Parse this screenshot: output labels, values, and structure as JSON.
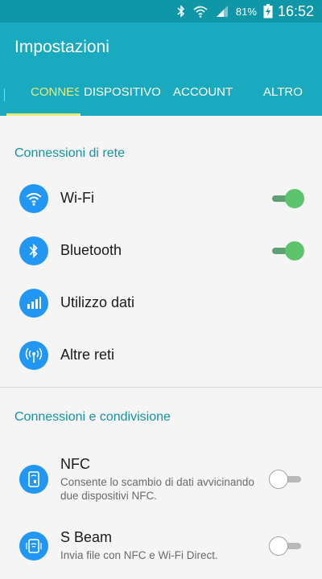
{
  "status_bar": {
    "battery": "81%",
    "time": "16:52"
  },
  "app_bar": {
    "title": "Impostazioni"
  },
  "tabs": [
    {
      "label": "CONNESSIONI"
    },
    {
      "label": "DISPOSITIVO"
    },
    {
      "label": "ACCOUNT"
    },
    {
      "label": "ALTRO"
    }
  ],
  "section1": {
    "header": "Connessioni di rete",
    "items": [
      {
        "label": "Wi-Fi",
        "toggle": true,
        "toggle_on": true
      },
      {
        "label": "Bluetooth",
        "toggle": true,
        "toggle_on": true
      },
      {
        "label": "Utilizzo dati"
      },
      {
        "label": "Altre reti"
      }
    ]
  },
  "section2": {
    "header": "Connessioni e condivisione",
    "items": [
      {
        "label": "NFC",
        "sub": "Consente lo scambio di dati avvicinando due dispositivi NFC.",
        "toggle_on": false
      },
      {
        "label": "S Beam",
        "sub": "Invia file con NFC e Wi-Fi Direct.",
        "toggle_on": false
      }
    ]
  },
  "colors": {
    "primary": "#1aaac0",
    "status_bar": "#0f97a8",
    "accent": "#e8ec7a",
    "icon_bg": "#2196f3",
    "section_text": "#1193a5",
    "toggle_on": "#5bc46c"
  },
  "icons": {
    "status": [
      "bluetooth-icon",
      "wifi-icon",
      "signal-icon",
      "battery-charging-icon"
    ],
    "rows": [
      "wifi-icon",
      "bluetooth-icon",
      "data-usage-icon",
      "antenna-icon",
      "nfc-icon",
      "s-beam-icon"
    ]
  }
}
